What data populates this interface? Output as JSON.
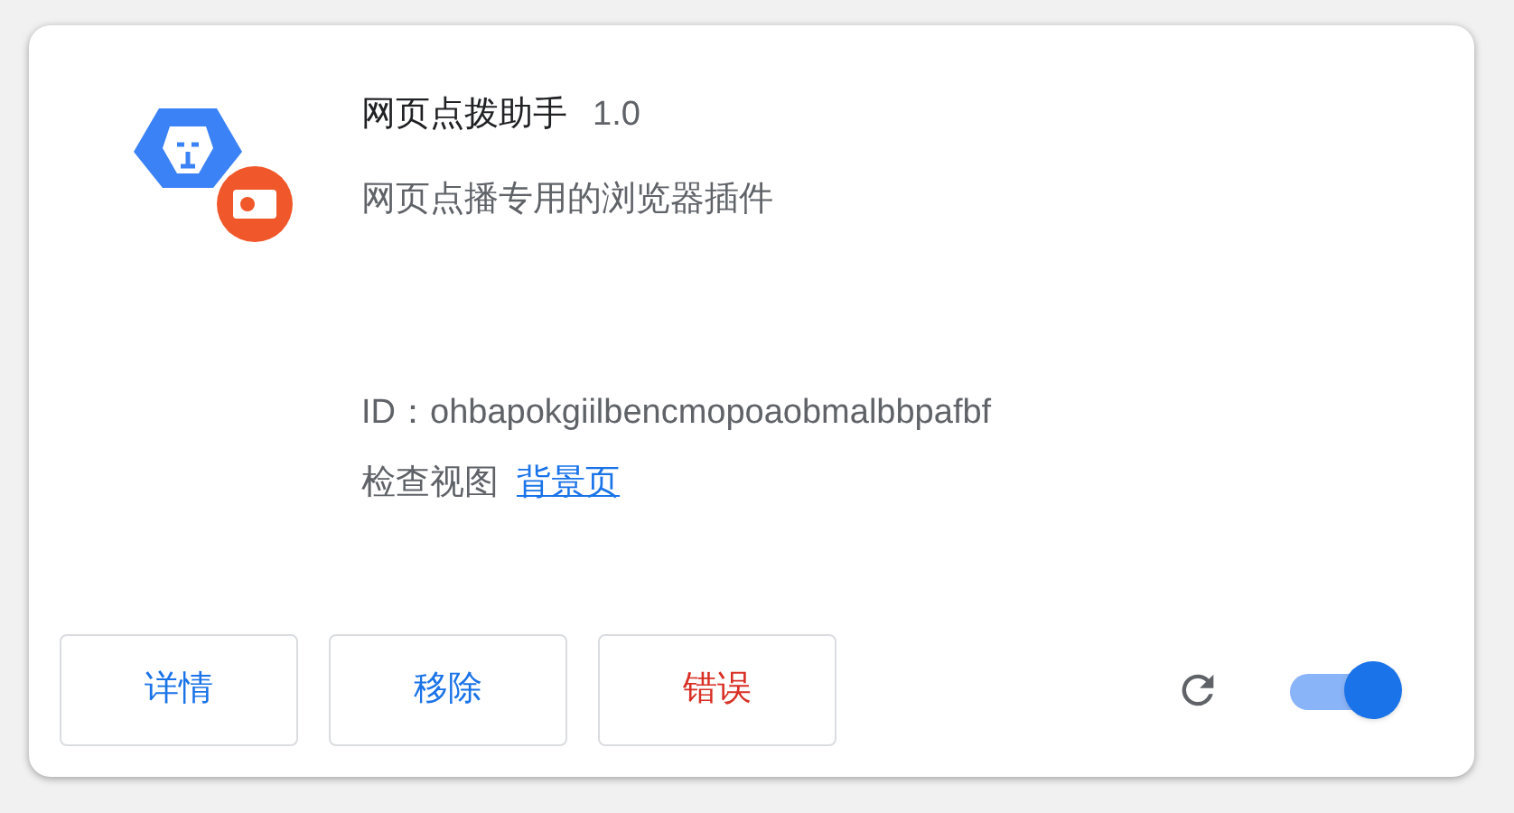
{
  "extension": {
    "name": "网页点拨助手",
    "version": "1.0",
    "description": "网页点播专用的浏览器插件",
    "id_label": "ID：",
    "id": "ohbapokgiilbencmopoaobmalbbpafbf",
    "inspect_label": "检查视图",
    "inspect_link": "背景页",
    "enabled": true
  },
  "buttons": [
    {
      "label": "详情",
      "kind": "normal"
    },
    {
      "label": "移除",
      "kind": "normal"
    },
    {
      "label": "错误",
      "kind": "error"
    }
  ]
}
